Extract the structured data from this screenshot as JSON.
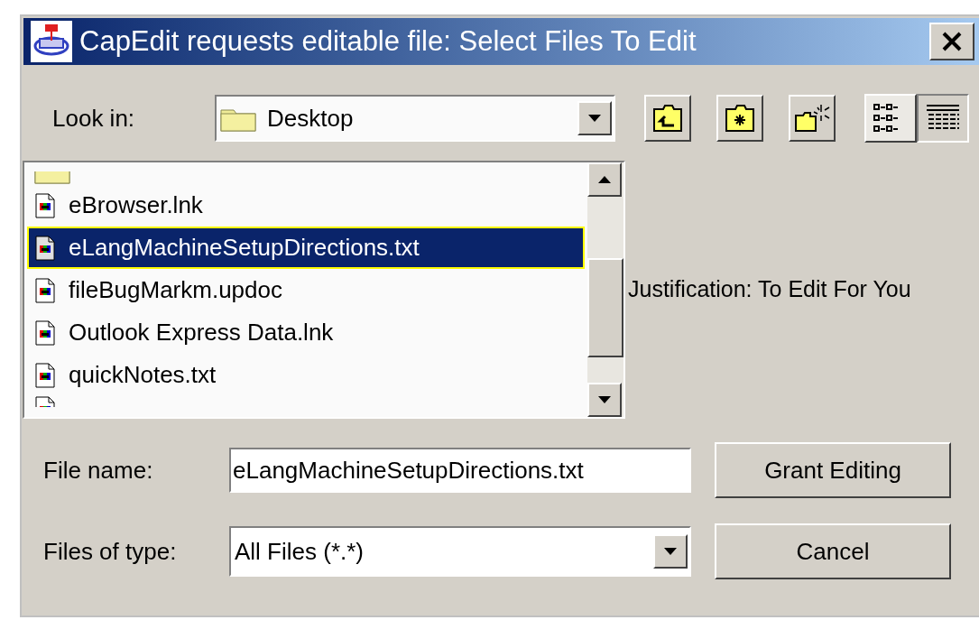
{
  "window": {
    "title": "CapEdit requests editable file: Select Files To Edit"
  },
  "look_in": {
    "label": "Look in:",
    "value": "Desktop"
  },
  "view_modes": [
    {
      "kind": "list",
      "selected": true
    },
    {
      "kind": "details",
      "selected": false
    }
  ],
  "files": [
    {
      "kind": "file",
      "name": "eBrowser.lnk",
      "selected": false
    },
    {
      "kind": "file",
      "name": "eLangMachineSetupDirections.txt",
      "selected": true
    },
    {
      "kind": "file",
      "name": "fileBugMarkm.updoc",
      "selected": false
    },
    {
      "kind": "file",
      "name": "Outlook Express Data.lnk",
      "selected": false
    },
    {
      "kind": "file",
      "name": "quickNotes.txt",
      "selected": false
    }
  ],
  "justification": "Justification: To Edit For You",
  "file_name": {
    "label": "File name:",
    "value": "eLangMachineSetupDirections.txt"
  },
  "files_of_type": {
    "label": "Files of type:",
    "value": "All Files (*.*)"
  },
  "buttons": [
    "Grant Editing",
    "Cancel"
  ]
}
